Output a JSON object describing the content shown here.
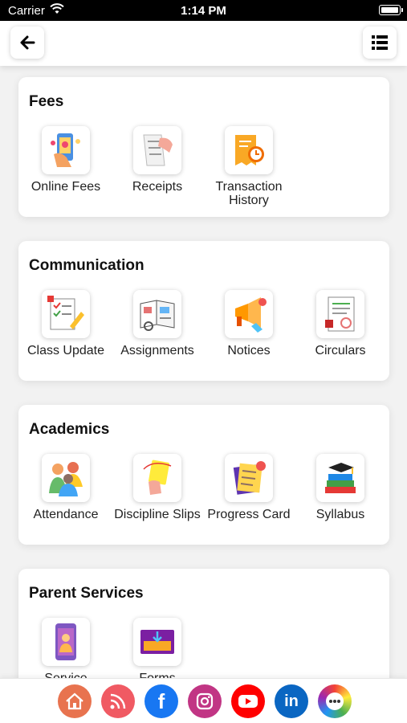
{
  "status_bar": {
    "carrier": "Carrier",
    "time": "1:14 PM"
  },
  "navbar": {
    "back_icon": "arrow-left-icon",
    "menu_icon": "list-icon"
  },
  "sections": [
    {
      "title": "Fees",
      "items": [
        {
          "label": "Online Fees",
          "icon": "online-fees-icon"
        },
        {
          "label": "Receipts",
          "icon": "receipts-icon"
        },
        {
          "label": "Transaction History",
          "icon": "transaction-history-icon"
        }
      ]
    },
    {
      "title": "Communication",
      "items": [
        {
          "label": "Class Update",
          "icon": "class-update-icon"
        },
        {
          "label": "Assignments",
          "icon": "assignments-icon"
        },
        {
          "label": "Notices",
          "icon": "megaphone-icon"
        },
        {
          "label": "Circulars",
          "icon": "circulars-icon"
        }
      ]
    },
    {
      "title": "Academics",
      "items": [
        {
          "label": "Attendance",
          "icon": "attendance-icon"
        },
        {
          "label": "Discipline Slips",
          "icon": "yellow-card-icon"
        },
        {
          "label": "Progress Card",
          "icon": "progress-card-icon"
        },
        {
          "label": "Syllabus",
          "icon": "books-icon"
        }
      ]
    },
    {
      "title": "Parent Services",
      "items": [
        {
          "label": "Service",
          "icon": "service-phone-icon"
        },
        {
          "label": "Forms",
          "icon": "forms-icon"
        }
      ]
    }
  ],
  "social_links": [
    {
      "name": "home",
      "icon": "home-icon",
      "color": "#e8734f"
    },
    {
      "name": "rss",
      "icon": "rss-icon",
      "color": "#f05a63"
    },
    {
      "name": "facebook",
      "icon": "facebook-icon",
      "color": "#1877f2",
      "glyph": "f"
    },
    {
      "name": "instagram",
      "icon": "instagram-icon",
      "color": "#c13584"
    },
    {
      "name": "youtube",
      "icon": "youtube-icon",
      "color": "#ff0000"
    },
    {
      "name": "linkedin",
      "icon": "linkedin-icon",
      "color": "#0a66c2",
      "glyph": "in"
    },
    {
      "name": "more",
      "icon": "more-icon",
      "color": "#6c5ce7"
    }
  ]
}
